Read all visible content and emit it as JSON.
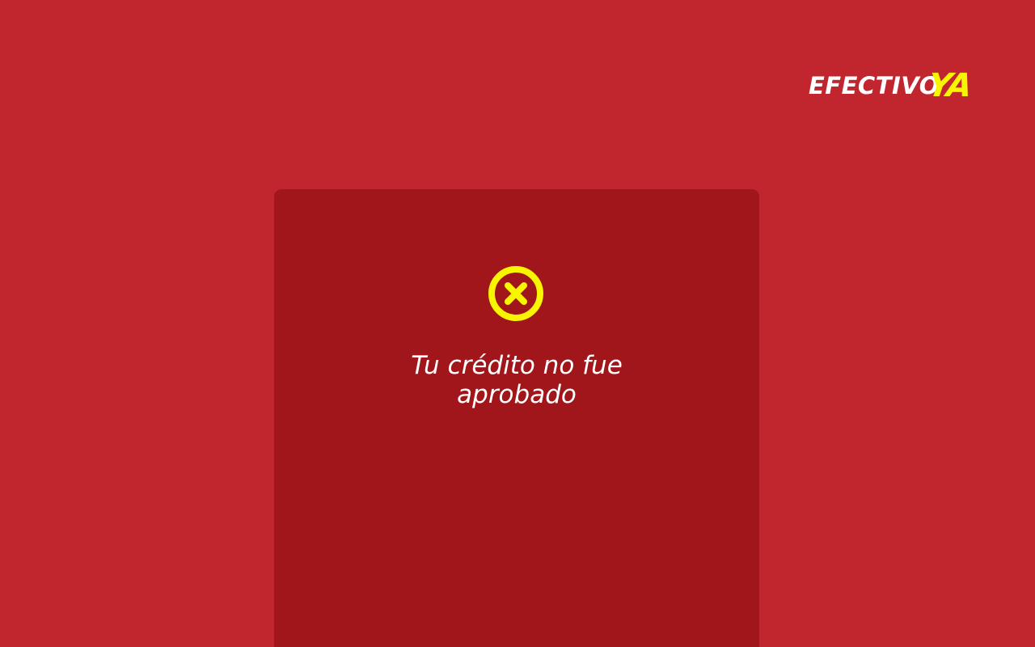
{
  "brand": {
    "wordmark": "EFECTIVO",
    "accent": "YA",
    "wordmark_color": "#ffffff",
    "accent_color": "#f7f500"
  },
  "colors": {
    "page_background": "#c1262f",
    "card_background": "#a0161b",
    "icon_color": "#f7f500",
    "text_color": "#ffffff"
  },
  "result": {
    "icon": "close-circle-icon",
    "message": "Tu crédito no fue aprobado"
  }
}
